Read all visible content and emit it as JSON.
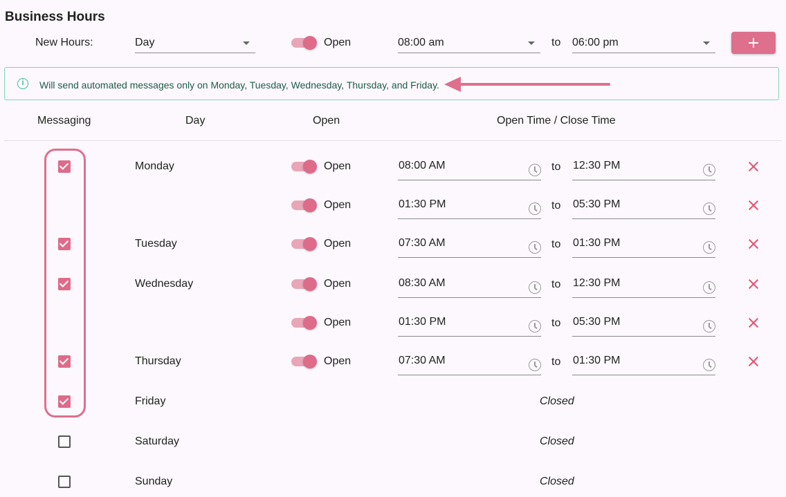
{
  "title": "Business Hours",
  "new_hours": {
    "label": "New Hours:",
    "day_value": "Day",
    "open_label": "Open",
    "from_value": "08:00 am",
    "to_label": "to",
    "to_value": "06:00 pm",
    "add_icon": "plus-icon"
  },
  "alert": {
    "icon": "info-icon",
    "text": "Will send automated messages only on Monday, Tuesday, Wednesday, Thursday, and Friday."
  },
  "headers": {
    "messaging": "Messaging",
    "day": "Day",
    "open": "Open",
    "times": "Open Time / Close Time"
  },
  "colors": {
    "accent": "#de6b8a",
    "alert_border": "#7ed6b4",
    "delete": "#e0556f"
  },
  "rows": [
    {
      "messaging": true,
      "day": "Monday",
      "open": "Open",
      "from": "08:00 AM",
      "to_label": "to",
      "to": "12:30 PM"
    },
    {
      "messaging": null,
      "day": "",
      "open": "Open",
      "from": "01:30 PM",
      "to_label": "to",
      "to": "05:30 PM"
    },
    {
      "messaging": true,
      "day": "Tuesday",
      "open": "Open",
      "from": "07:30 AM",
      "to_label": "to",
      "to": "01:30 PM"
    },
    {
      "messaging": true,
      "day": "Wednesday",
      "open": "Open",
      "from": "08:30 AM",
      "to_label": "to",
      "to": "12:30 PM"
    },
    {
      "messaging": null,
      "day": "",
      "open": "Open",
      "from": "01:30 PM",
      "to_label": "to",
      "to": "05:30 PM"
    },
    {
      "messaging": true,
      "day": "Thursday",
      "open": "Open",
      "from": "07:30 AM",
      "to_label": "to",
      "to": "01:30 PM"
    },
    {
      "messaging": true,
      "day": "Friday",
      "closed": "Closed"
    },
    {
      "messaging": false,
      "day": "Saturday",
      "closed": "Closed"
    },
    {
      "messaging": false,
      "day": "Sunday",
      "closed": "Closed"
    }
  ]
}
